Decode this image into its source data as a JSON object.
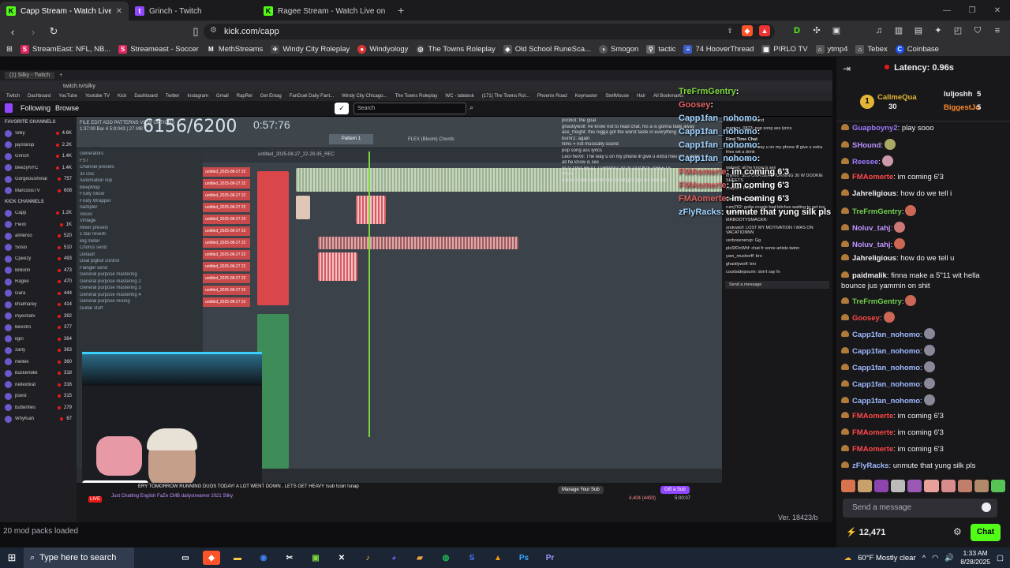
{
  "browser": {
    "tabs": [
      {
        "title": "Capp Stream - Watch Live on",
        "active": true,
        "icon": "kick-icon"
      },
      {
        "title": "Grinch - Twitch",
        "active": false,
        "icon": "twitch-icon"
      },
      {
        "title": "Ragee Stream - Watch Live on Kick",
        "active": false,
        "icon": "kick-icon"
      }
    ],
    "url": "kick.com/capp",
    "bookmarks": [
      "StreamEast: NFL, NB...",
      "Streameast - Soccer",
      "MethStreams",
      "Windy City Roleplay",
      "Windyology",
      "The Towns Roleplay",
      "Old School RuneSca...",
      "Smogon",
      "tactic",
      "74 HooverThread",
      "PIRLO TV",
      "ytmp4",
      "Tebex",
      "Coinbase"
    ]
  },
  "stream": {
    "inner_url": "twitch.tv/silky",
    "inner_nav": {
      "following": "Following",
      "browse": "Browse",
      "search_placeholder": "Search"
    },
    "counter": "6156/6200",
    "timer": "0:57:76",
    "sidebar_heading_favorite": "FAVORITE CHANNELS",
    "sidebar_heading_kick": "KICK CHANNELS",
    "favorite_channels": [
      {
        "name": "Silky",
        "game": "Just Chatting",
        "viewers": "4.6K"
      },
      {
        "name": "jaystarup",
        "game": "Grand Theft Au...",
        "viewers": "2.2K"
      },
      {
        "name": "Grinch",
        "game": "Grand Theft Au...",
        "viewers": "1.4K"
      },
      {
        "name": "BeezyNYC",
        "game": "Grand Theft Au...",
        "viewers": "1.4K"
      },
      {
        "name": "Gorgeousminal",
        "game": "Grand Theft Au...",
        "viewers": "757"
      },
      {
        "name": "MarcosisTV",
        "game": "Grand Theft Au...",
        "viewers": "608"
      }
    ],
    "kick_channels": [
      {
        "name": "Capp",
        "game": "Grand Theft Au...",
        "viewers": "1.2K"
      },
      {
        "name": "Flexx",
        "game": "Grand Theft Au...",
        "viewers": "1K"
      },
      {
        "name": "amleroo",
        "game": "Grand Theft Au...",
        "viewers": "520"
      },
      {
        "name": "Sosio",
        "game": "Marvel Rivals",
        "viewers": "510"
      },
      {
        "name": "Cpeezy",
        "game": "IRL",
        "viewers": "493"
      },
      {
        "name": "Billionn",
        "game": "Grand Theft Au...",
        "viewers": "473"
      },
      {
        "name": "Ragee",
        "game": "Grand Theft Au...",
        "viewers": "470"
      },
      {
        "name": "Gara",
        "game": "Grand Theft Au...",
        "viewers": "444"
      },
      {
        "name": "khalmarey",
        "game": "Just Chatting",
        "viewers": "414"
      },
      {
        "name": "myeshatv",
        "game": "Grand Theft Au...",
        "viewers": "392"
      },
      {
        "name": "Bexstro",
        "game": "Grand Theft Au...",
        "viewers": "377"
      },
      {
        "name": "ilgiri",
        "game": "Grand Theft Au...",
        "viewers": "364"
      },
      {
        "name": "zarty",
        "game": "Grand Theft Au...",
        "viewers": "363"
      },
      {
        "name": "mellek",
        "game": "Grand Theft Au...",
        "viewers": "360"
      },
      {
        "name": "buckendkk",
        "game": "Grand Theft Au...",
        "viewers": "318"
      },
      {
        "name": "nellexbrat",
        "game": "Grand Theft Au...",
        "viewers": "316"
      },
      {
        "name": "poest",
        "game": "Grand Theft Au...",
        "viewers": "315"
      },
      {
        "name": "butterfiles",
        "game": "Grand Theft Au...",
        "viewers": "279"
      },
      {
        "name": "WhyKiah",
        "game": "Grand Theft Au...",
        "viewers": "67"
      }
    ],
    "browser_items": [
      "Generators",
      "FST",
      "Channel presets",
      "3x Osc",
      "Automation clip",
      "BeepMap",
      "Fruity Slicer",
      "Fruity Wrapper",
      "Sampler",
      "Slicex",
      "Vintage",
      "Mixer presets",
      "1 Bar reverb",
      "Big meter",
      "Chorus send",
      "Default",
      "Dual pigbuf control",
      "Flanger send",
      "General purpose mastering",
      "General purpose mastering 2",
      "General purpose mastering 3",
      "General purpose mastering 4",
      "General purpose mixing",
      "Guitar stuff"
    ],
    "playlist_title": "untitled_2025-08-27_22-28-35_REC",
    "tracks": [
      "untitled_2025-08-27 22",
      "untitled_2025-08-27 22",
      "untitled_2025-08-27 22",
      "untitled_2025-08-27 22",
      "untitled_2025-08-27 22",
      "untitled_2025-08-27 22",
      "untitled_2025-08-27 22",
      "untitled_2025-08-27 22",
      "untitled_2025-08-27 22",
      "untitled_2025-08-27 22",
      "untitled_2025-08-27 22",
      "untitled_2025-08-27 22"
    ],
    "overlay_chat": [
      {
        "user": "TreFrmGentry",
        "text": ":",
        "color": "#7cd63e"
      },
      {
        "user": "Goosey",
        "text": ":",
        "color": "#e06060"
      },
      {
        "user": "Capp1fan_nohomo",
        "text": ":",
        "color": "#9fd3ff"
      },
      {
        "user": "Capp1fan_nohomo",
        "text": ":",
        "color": "#9fd3ff"
      },
      {
        "user": "Capp1fan_nohomo",
        "text": ":",
        "color": "#9fd3ff"
      },
      {
        "user": "Capp1fan_nohomo",
        "text": ":",
        "color": "#9fd3ff"
      },
      {
        "user": "FMAomerte",
        "text": ": im coming 6'3",
        "color": "#e06060"
      },
      {
        "user": "FMAomerte",
        "text": ": im coming 6'3",
        "color": "#e06060"
      },
      {
        "user": "FMAomerte",
        "text": ": im coming 6'3",
        "color": "#e06060"
      },
      {
        "user": "zFlyRacks",
        "text": ": unmute that yung silk pls",
        "color": "#9fd3ff"
      }
    ],
    "top_chat": [
      "pirobot: the goat",
      "ghastlywolf: he know not to read chat, his a is gonna fade away",
      "ace_freight: this nigga got the worst taste in everything",
      "burnr2: again",
      "Nms = not musically sound",
      "pop song ass lyrics",
      "LeoTheXII: The way u on my phone ill give u extra fries wit a drink",
      "all he know is sex",
      "SLG ONA BEAT TURNING 30 W DOOKIE SHEETS",
      "PINN",
      "gotta couple bad bitches waiting to get ina bed wit"
    ],
    "right_chat": [
      "not musically sound",
      "martyrs_0823: pop song ass lyrics",
      "First Time Chat",
      "LeoTheXII: The way u on my phone ill give u extra fries wit a drink",
      "cozyian: PIN",
      "walsed: all he know is sex",
      "khyreo: SLG ONA BEAT TURNING 30 W DOOKIE SHEETS",
      "cozyian: PINN",
      "First Time Chat",
      "rumj762: gotta couple bad bitches waiting to get ina bed with me",
      "MRBOOTYSMACKR:",
      "ondowlof: LOST MY MOTIVATION I WAS ON VACATIONNN",
      "verbosenerup: Gg",
      "plsSfOnWhf: chat fr some artists twinn",
      "yam_mushorff: bro",
      "ghastlywolf: bro",
      "courtsidepourin: don't say fn",
      "Send a message"
    ],
    "stream_title": "ERY TOMORROW RUNNING DUOS TODAY! A LOT WENT DOWN , LETS GET HEAVY !sub !coin !snap",
    "stream_tags": "Just Chatting   English   FaZe   CMB   dailystreamer   2021   Silky",
    "viewers_inner": "4,404 (4493)",
    "uptime_inner": "5:00:07",
    "manage_sub": "Manage Your Sub",
    "gift_sub": "Gift a Sub",
    "live_label": "LIVE",
    "mod_packs": "20 mod packs loaded",
    "version": "Ver. 18423/b"
  },
  "chat": {
    "latency": "Latency: 0.96s",
    "leaderboard": [
      {
        "name": "CallmeQua",
        "count": "30",
        "color": "#e5b635"
      },
      {
        "name": "luljoshh",
        "count": "5",
        "color": "#ddd"
      },
      {
        "name": "BiggestJo",
        "count": "5",
        "color": "#ff8a2a"
      }
    ],
    "messages": [
      {
        "user": "Guapboyny2",
        "text": ": play sooo",
        "color": "#9d7bff"
      },
      {
        "user": "SHound",
        "text": ":",
        "color": "#bf94ff"
      },
      {
        "user": "Reesee",
        "text": ":",
        "color": "#9d7bff"
      },
      {
        "user": "FMAomerte",
        "text": ": im coming 6'3",
        "color": "#ff4747"
      },
      {
        "user": "Jahreligious",
        "text": ": how do we tell i",
        "color": "#efeff1"
      },
      {
        "user": "TreFrmGentry",
        "text": ":",
        "color": "#72d04b"
      },
      {
        "user": "Noluv_tahj",
        "text": ":",
        "color": "#bf94ff"
      },
      {
        "user": "Noluv_tahj",
        "text": ":",
        "color": "#bf94ff"
      },
      {
        "user": "Jahreligious",
        "text": ": how do we tell u",
        "color": "#efeff1"
      },
      {
        "user": "paidmalik",
        "text": ": finna make a 5\"11 wit hella bounce jus yammin on shit",
        "color": "#efeff1"
      },
      {
        "user": "TreFrmGentry",
        "text": ":",
        "color": "#72d04b"
      },
      {
        "user": "Goosey",
        "text": ":",
        "color": "#ff4747"
      },
      {
        "user": "Capp1fan_nohomo",
        "text": ":",
        "color": "#9fb9ff"
      },
      {
        "user": "Capp1fan_nohomo",
        "text": ":",
        "color": "#9fb9ff"
      },
      {
        "user": "Capp1fan_nohomo",
        "text": ":",
        "color": "#9fb9ff"
      },
      {
        "user": "Capp1fan_nohomo",
        "text": ":",
        "color": "#9fb9ff"
      },
      {
        "user": "Capp1fan_nohomo",
        "text": ":",
        "color": "#9fb9ff"
      },
      {
        "user": "FMAomerte",
        "text": ": im coming 6'3",
        "color": "#ff4747"
      },
      {
        "user": "FMAomerte",
        "text": ": im coming 6'3",
        "color": "#ff4747"
      },
      {
        "user": "FMAomerte",
        "text": ": im coming 6'3",
        "color": "#ff4747"
      },
      {
        "user": "zFlyRacks",
        "text": ": unmute that yung silk pls",
        "color": "#9fb9ff"
      }
    ],
    "send_placeholder": "Send a message",
    "points": "12,471",
    "chat_button": "Chat"
  },
  "taskbar": {
    "search_placeholder": "Type here to search",
    "weather": "60°F  Mostly clear",
    "time": "1:33 AM",
    "date": "8/28/2025"
  }
}
